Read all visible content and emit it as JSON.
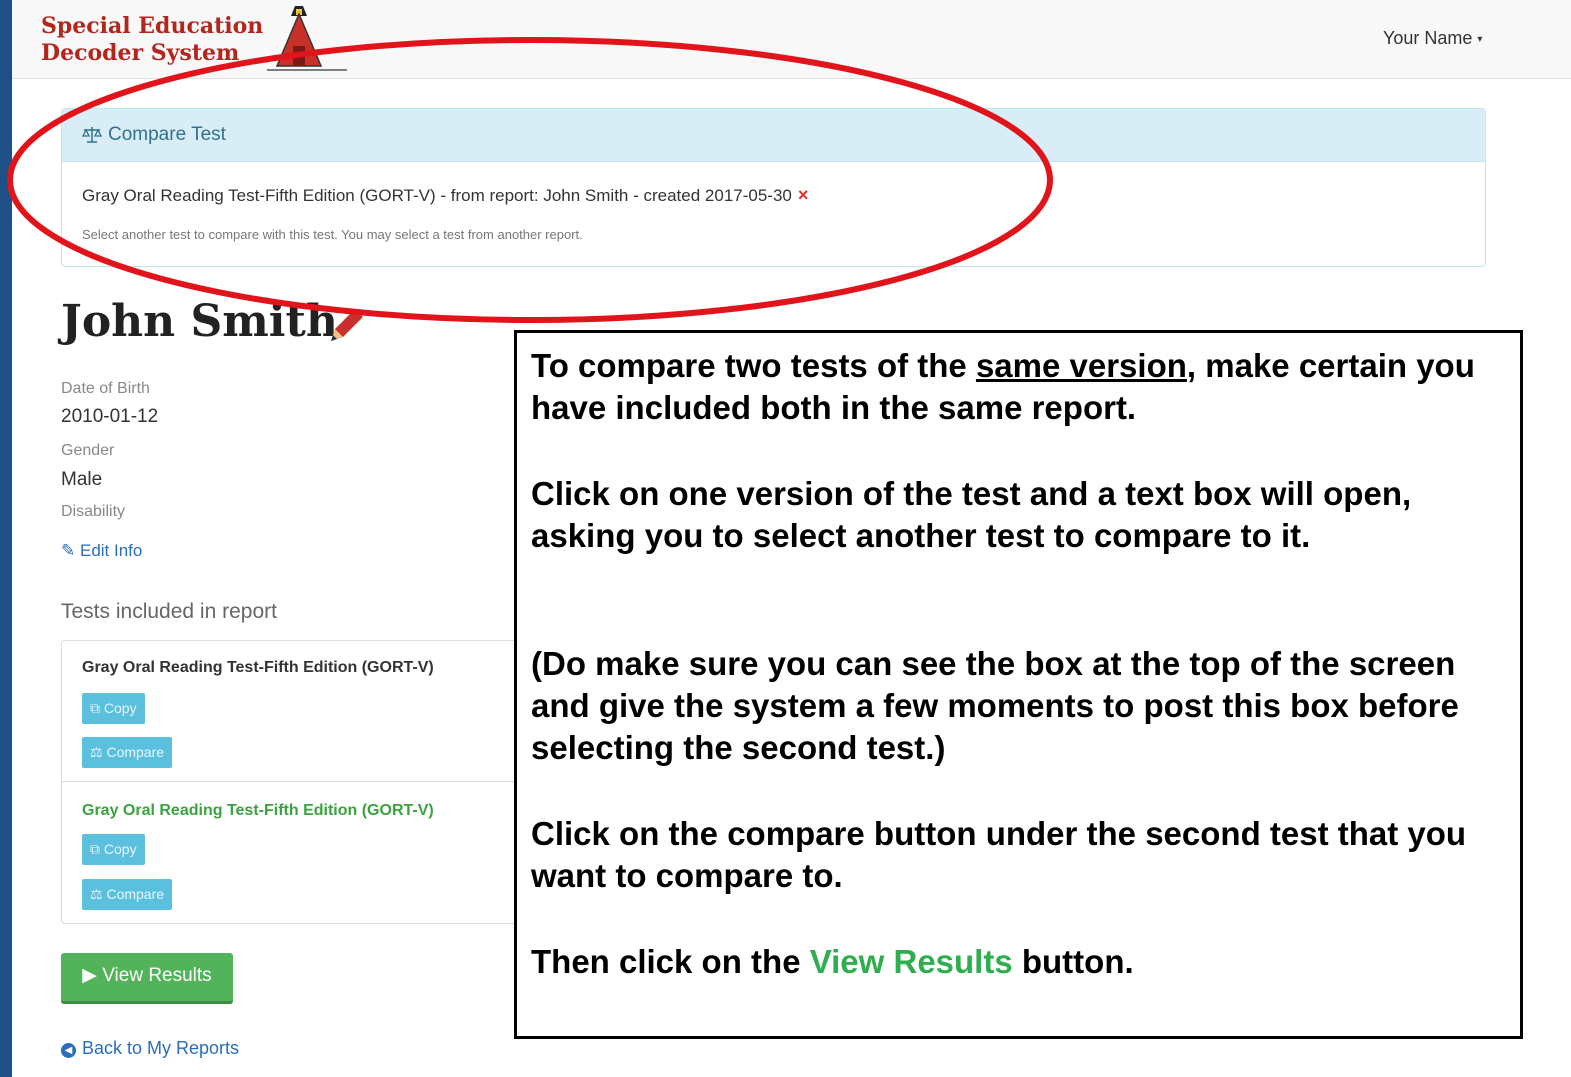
{
  "header": {
    "brand_line1": "Special Education",
    "brand_line2": "Decoder System",
    "user_menu": "Your Name"
  },
  "compare_panel": {
    "title": "Compare Test",
    "selected_test": "Gray Oral Reading Test-Fifth Edition (GORT-V) - from report: John Smith - created 2017-05-30",
    "remove_icon": "×",
    "help_text": "Select another test to compare with this test. You may select a test from another report."
  },
  "student": {
    "name": "John Smith",
    "dob_label": "Date of Birth",
    "dob": "2010-01-12",
    "gender_label": "Gender",
    "gender": "Male",
    "disability_label": "Disability",
    "edit_info": "Edit Info"
  },
  "tests": {
    "heading": "Tests included in report",
    "items": [
      {
        "title": "Gray Oral Reading Test-Fifth Edition (GORT-V)",
        "copy": "Copy",
        "compare": "Compare"
      },
      {
        "title": "Gray Oral Reading Test-Fifth Edition (GORT-V)",
        "copy": "Copy",
        "compare": "Compare"
      }
    ]
  },
  "actions": {
    "view_results": "View Results",
    "back": "Back to My Reports"
  },
  "callout": {
    "p1_pre": "To compare two tests of the ",
    "p1_underline": "same version",
    "p1_post": ", make certain you have included both in the same report.",
    "p2": "Click on one version of the test and a text box will open, asking you to select another test to compare to it.",
    "p3": "(Do make sure you can see the box at the top of the screen and give the system a few moments to post this box before selecting the second test.)",
    "p4": "Click on the compare button under the second test that you want to compare to.",
    "p5_pre": "Then click on the ",
    "p5_green": "View Results",
    "p5_post": " button."
  },
  "colors": {
    "frame_border": "#1f4f87",
    "brand": "#b3261e",
    "annotation_ellipse": "#e0141a",
    "info_button": "#5bc0de",
    "success_button": "#52b35b",
    "callout_green": "#2eae4f"
  }
}
